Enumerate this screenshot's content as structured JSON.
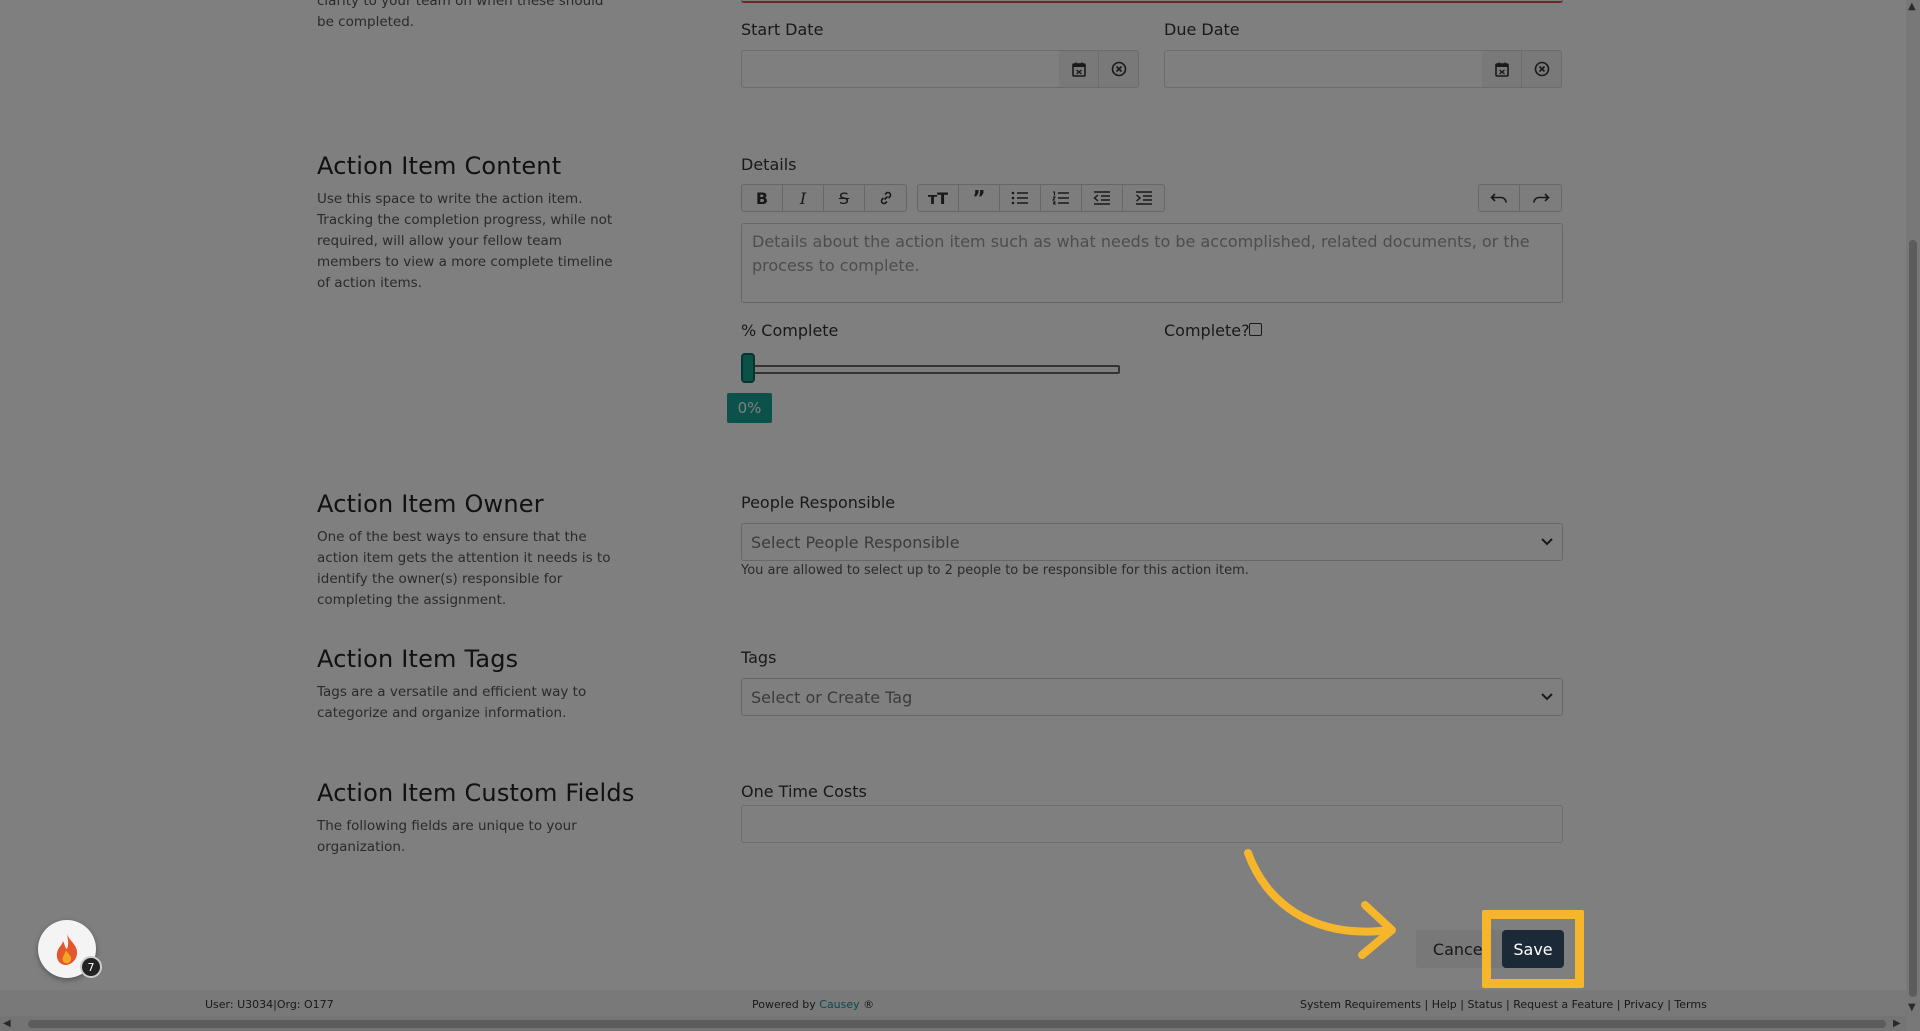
{
  "top_section": {
    "desc_partial": "clarity to your team on when these should be completed.",
    "start_date_label": "Start Date",
    "due_date_label": "Due Date"
  },
  "content_section": {
    "title": "Action Item Content",
    "description": "Use this space to write the action item. Tracking the completion progress, while not required, will allow your fellow team members to view a more complete timeline of action items.",
    "details_label": "Details",
    "details_placeholder": "Details about the action item such as what needs to be accomplished, related documents, or the process to complete.",
    "percent_label": "% Complete",
    "percent_value": "0%",
    "percent_fraction": 0,
    "complete_label": "Complete?",
    "complete_checked": false
  },
  "owner_section": {
    "title": "Action Item Owner",
    "description": "One of the best ways to ensure that the action item gets the attention it needs is to identify the owner(s) responsible for completing the assignment.",
    "people_label": "People Responsible",
    "people_placeholder": "Select People Responsible",
    "people_help": "You are allowed to select up to 2 people to be responsible for this action item."
  },
  "tags_section": {
    "title": "Action Item Tags",
    "description": "Tags are a versatile and efficient way to categorize and organize information.",
    "tags_label": "Tags",
    "tags_placeholder": "Select or Create Tag"
  },
  "custom_section": {
    "title": "Action Item Custom Fields",
    "description": "The following fields are unique to your organization.",
    "one_time_costs_label": "One Time Costs",
    "one_time_costs_value": ""
  },
  "actions": {
    "cancel_label": "Cancel",
    "save_label": "Save"
  },
  "fab": {
    "badge_count": "7"
  },
  "footer": {
    "user_info": "User: U3034|Org: O177",
    "powered_prefix": "Powered by",
    "brand": "Causey",
    "brand_suffix": "®",
    "links": "System Requirements | Help | Status | Request a Feature | Privacy | Terms"
  },
  "colors": {
    "accent_teal": "#1ba595",
    "save_button": "#17324a",
    "highlight": "#f5b62b",
    "overlay": "rgba(0,0,0,0.5)"
  }
}
